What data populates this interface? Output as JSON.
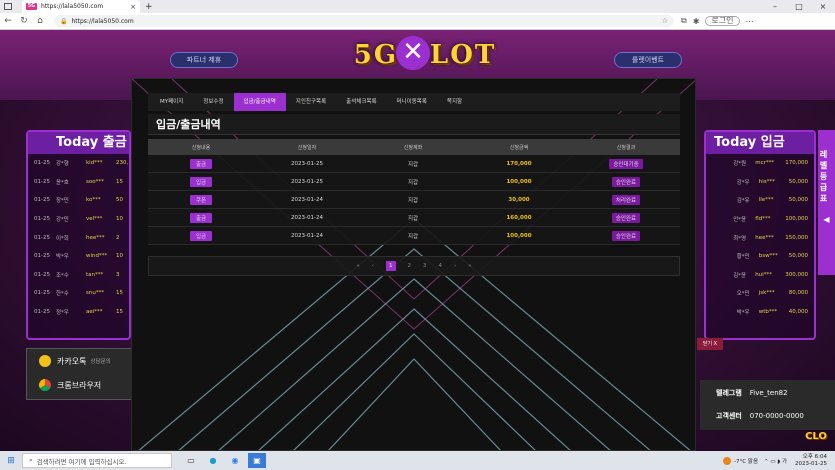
{
  "browser": {
    "tab_favicon": "5G",
    "tab_title": "https://lala5050.com",
    "url": "https://lala5050.com",
    "login_label": "로그인"
  },
  "site": {
    "logo_text": "5G SLOT",
    "partner_btn": "파트너 제휴",
    "event_btn": "룰렛이벤트",
    "left_panel_title": "Today 출금",
    "right_panel_title": "Today 입금",
    "left_rows": [
      {
        "date": "01-25",
        "name": "강*형",
        "id": "kid***",
        "amt": "230,"
      },
      {
        "date": "01-25",
        "name": "윤*호",
        "id": "soo***",
        "amt": "15"
      },
      {
        "date": "01-25",
        "name": "장*민",
        "id": "ko***",
        "amt": "50"
      },
      {
        "date": "01-25",
        "name": "강*민",
        "id": "vel***",
        "amt": "10"
      },
      {
        "date": "01-25",
        "name": "이*희",
        "id": "hee***",
        "amt": "2"
      },
      {
        "date": "01-25",
        "name": "박*우",
        "id": "wind***",
        "amt": "10"
      },
      {
        "date": "01-25",
        "name": "조*수",
        "id": "tan***",
        "amt": "3"
      },
      {
        "date": "01-25",
        "name": "한*수",
        "id": "snu***",
        "amt": "15"
      },
      {
        "date": "01-25",
        "name": "정*우",
        "id": "aei***",
        "amt": "15"
      }
    ],
    "right_rows": [
      {
        "name": "강*원",
        "id": "mcr***",
        "amt": "170,000"
      },
      {
        "name": "강*우",
        "id": "his***",
        "amt": "50,000"
      },
      {
        "name": "김*유",
        "id": "lle***",
        "amt": "50,000"
      },
      {
        "name": "안*윤",
        "id": "fld***",
        "amt": "100,000"
      },
      {
        "name": "최*영",
        "id": "hee***",
        "amt": "150,000"
      },
      {
        "name": "황*민",
        "id": "bsw***",
        "amt": "50,000"
      },
      {
        "name": "김*윤",
        "id": "hui***",
        "amt": "300,000"
      },
      {
        "name": "오*민",
        "id": "jsk***",
        "amt": "80,000"
      },
      {
        "name": "박*우",
        "id": "wtb***",
        "amt": "40,000"
      }
    ],
    "kakao_label": "카카오톡",
    "kakao_sub": "상담문의",
    "chrome_label": "크롬브라우저",
    "telegram_label": "텔레그램",
    "telegram_value": "Five_ten82",
    "service_label": "고객센터",
    "service_value": "070-0000-0000",
    "level_bar_label": "레벨등급표",
    "level_bar_arrow": "◀",
    "side_tag": "닫기 X",
    "corner_badge": "CLO"
  },
  "modal": {
    "close_symbol": "✕",
    "tabs": [
      "MY페이지",
      "정보수정",
      "입금/출금내역",
      "지인친구목록",
      "출석체크목록",
      "머니이동목록",
      "쪽지함"
    ],
    "active_tab": 2,
    "section_title": "입금/출금내역",
    "columns": [
      "신청내용",
      "신청일자",
      "신청계좌",
      "신청금액",
      "신청결과"
    ],
    "rows": [
      {
        "type": "출금",
        "date": "2023-01-25",
        "account": "지갑",
        "amount": "170,000",
        "result": "승인대기중"
      },
      {
        "type": "입금",
        "date": "2023-01-25",
        "account": "지갑",
        "amount": "100,000",
        "result": "승인완료"
      },
      {
        "type": "쿠폰",
        "date": "2023-01-24",
        "account": "지갑",
        "amount": "30,000",
        "result": "처리완료"
      },
      {
        "type": "출금",
        "date": "2023-01-24",
        "account": "지갑",
        "amount": "160,000",
        "result": "승인완료"
      },
      {
        "type": "입금",
        "date": "2023-01-24",
        "account": "지갑",
        "amount": "100,000",
        "result": "승인완료"
      }
    ],
    "pager": [
      "«",
      "‹",
      "1",
      "2",
      "3",
      "4",
      "›",
      "»"
    ],
    "current_page": "1"
  },
  "taskbar": {
    "search_placeholder": "검색하려면 여기에 입력하십시오.",
    "weather": "-7°C 맑음",
    "time": "오후 6:04",
    "date": "2023-01-25"
  },
  "colors": {
    "accent": "#9b2fcf",
    "amount": "#f2c21b"
  }
}
